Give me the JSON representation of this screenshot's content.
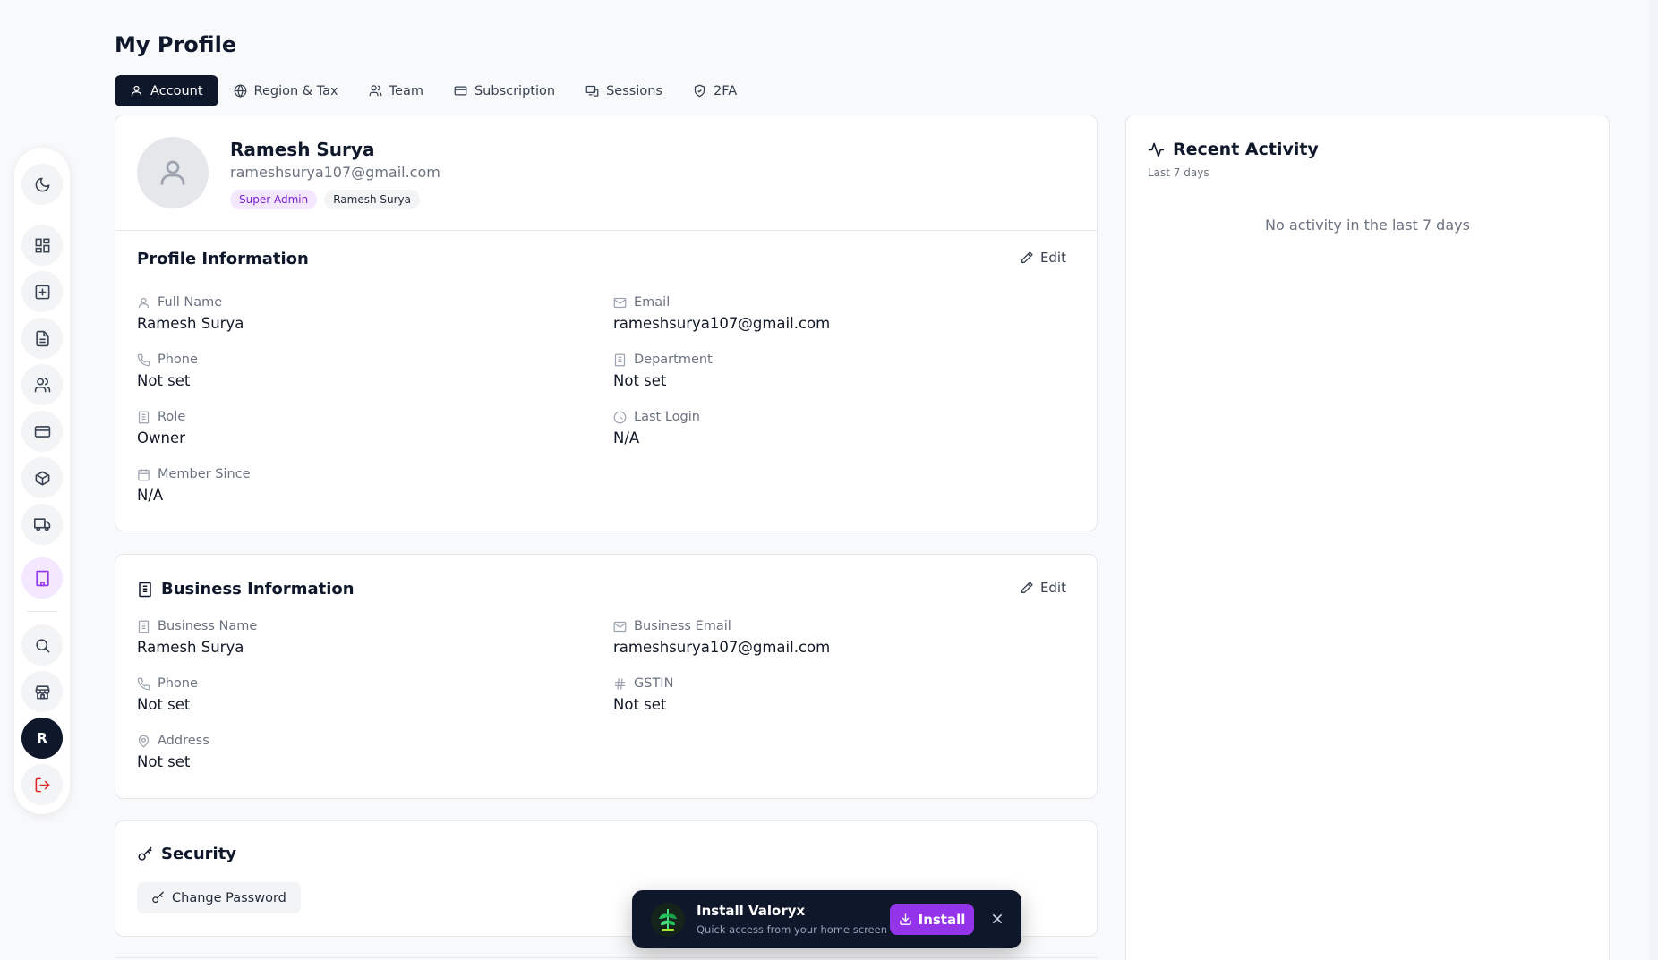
{
  "page": {
    "title": "My Profile"
  },
  "tabs": [
    {
      "label": "Account",
      "icon": "user-icon",
      "active": true
    },
    {
      "label": "Region & Tax",
      "icon": "globe-icon"
    },
    {
      "label": "Team",
      "icon": "users-icon"
    },
    {
      "label": "Subscription",
      "icon": "credit-card-icon"
    },
    {
      "label": "Sessions",
      "icon": "devices-icon"
    },
    {
      "label": "2FA",
      "icon": "shield-check-icon"
    }
  ],
  "sidebar": {
    "items": [
      {
        "icon": "moon-icon"
      },
      {
        "icon": "dashboard-icon"
      },
      {
        "icon": "plus-square-icon"
      },
      {
        "icon": "document-icon"
      },
      {
        "icon": "users-icon"
      },
      {
        "icon": "credit-card-icon"
      },
      {
        "icon": "package-icon"
      },
      {
        "icon": "truck-icon"
      },
      {
        "icon": "building-icon",
        "active": true
      },
      {
        "icon": "search-icon"
      },
      {
        "icon": "store-icon"
      },
      {
        "icon": "avatar",
        "label": "R"
      },
      {
        "icon": "logout-icon"
      }
    ],
    "active_color": "#9333ea",
    "logout_color": "#dc2626"
  },
  "profile": {
    "name": "Ramesh Surya",
    "email": "rameshsurya107@gmail.com",
    "badges": [
      "Super Admin",
      "Ramesh Surya"
    ]
  },
  "profile_info": {
    "title": "Profile Information",
    "edit_label": "Edit",
    "fields": [
      {
        "label": "Full Name",
        "value": "Ramesh Surya",
        "icon": "user-icon"
      },
      {
        "label": "Email",
        "value": "rameshsurya107@gmail.com",
        "icon": "mail-icon"
      },
      {
        "label": "Phone",
        "value": "Not set",
        "icon": "phone-icon"
      },
      {
        "label": "Department",
        "value": "Not set",
        "icon": "building-icon"
      },
      {
        "label": "Role",
        "value": "Owner",
        "icon": "building-icon"
      },
      {
        "label": "Last Login",
        "value": "N/A",
        "icon": "clock-icon"
      },
      {
        "label": "Member Since",
        "value": "N/A",
        "icon": "calendar-icon"
      }
    ]
  },
  "business_info": {
    "title": "Business Information",
    "edit_label": "Edit",
    "fields": [
      {
        "label": "Business Name",
        "value": "Ramesh Surya",
        "icon": "building-icon"
      },
      {
        "label": "Business Email",
        "value": "rameshsurya107@gmail.com",
        "icon": "mail-icon"
      },
      {
        "label": "Phone",
        "value": "Not set",
        "icon": "phone-icon"
      },
      {
        "label": "GSTIN",
        "value": "Not set",
        "icon": "hash-icon"
      },
      {
        "label": "Address",
        "value": "Not set",
        "icon": "map-pin-icon"
      }
    ]
  },
  "security": {
    "title": "Security",
    "change_password_label": "Change Password"
  },
  "activity": {
    "title": "Recent Activity",
    "subtitle": "Last 7 days",
    "empty_text": "No activity in the last 7 days"
  },
  "install_toast": {
    "title": "Install Valoryx",
    "subtitle": "Quick access from your home screen",
    "button_label": "Install",
    "accent": "#9333ea"
  }
}
